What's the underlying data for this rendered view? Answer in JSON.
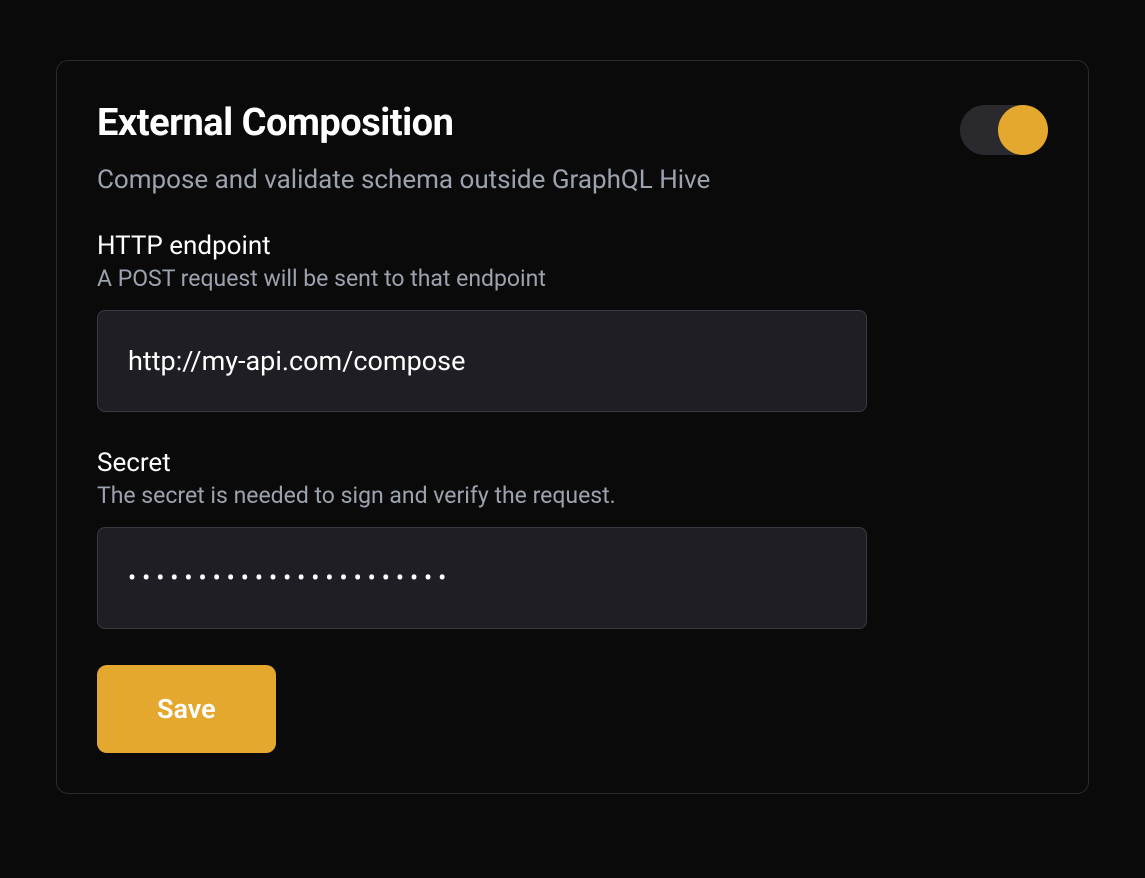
{
  "card": {
    "title": "External Composition",
    "subtitle": "Compose and validate schema outside GraphQL Hive",
    "toggle_enabled": true
  },
  "fields": {
    "endpoint": {
      "label": "HTTP endpoint",
      "description": "A POST request will be sent to that endpoint",
      "placeholder": "http://my-api.com/compose",
      "value": ""
    },
    "secret": {
      "label": "Secret",
      "description": "The secret is needed to sign and verify the request.",
      "value": "•••••••••••••••••••••••"
    }
  },
  "actions": {
    "save_label": "Save"
  },
  "colors": {
    "accent": "#e5a82e",
    "background": "#0a0a0a",
    "input_bg": "#1e1e24",
    "border": "#2a2a2e",
    "text_muted": "#9ca3af"
  }
}
